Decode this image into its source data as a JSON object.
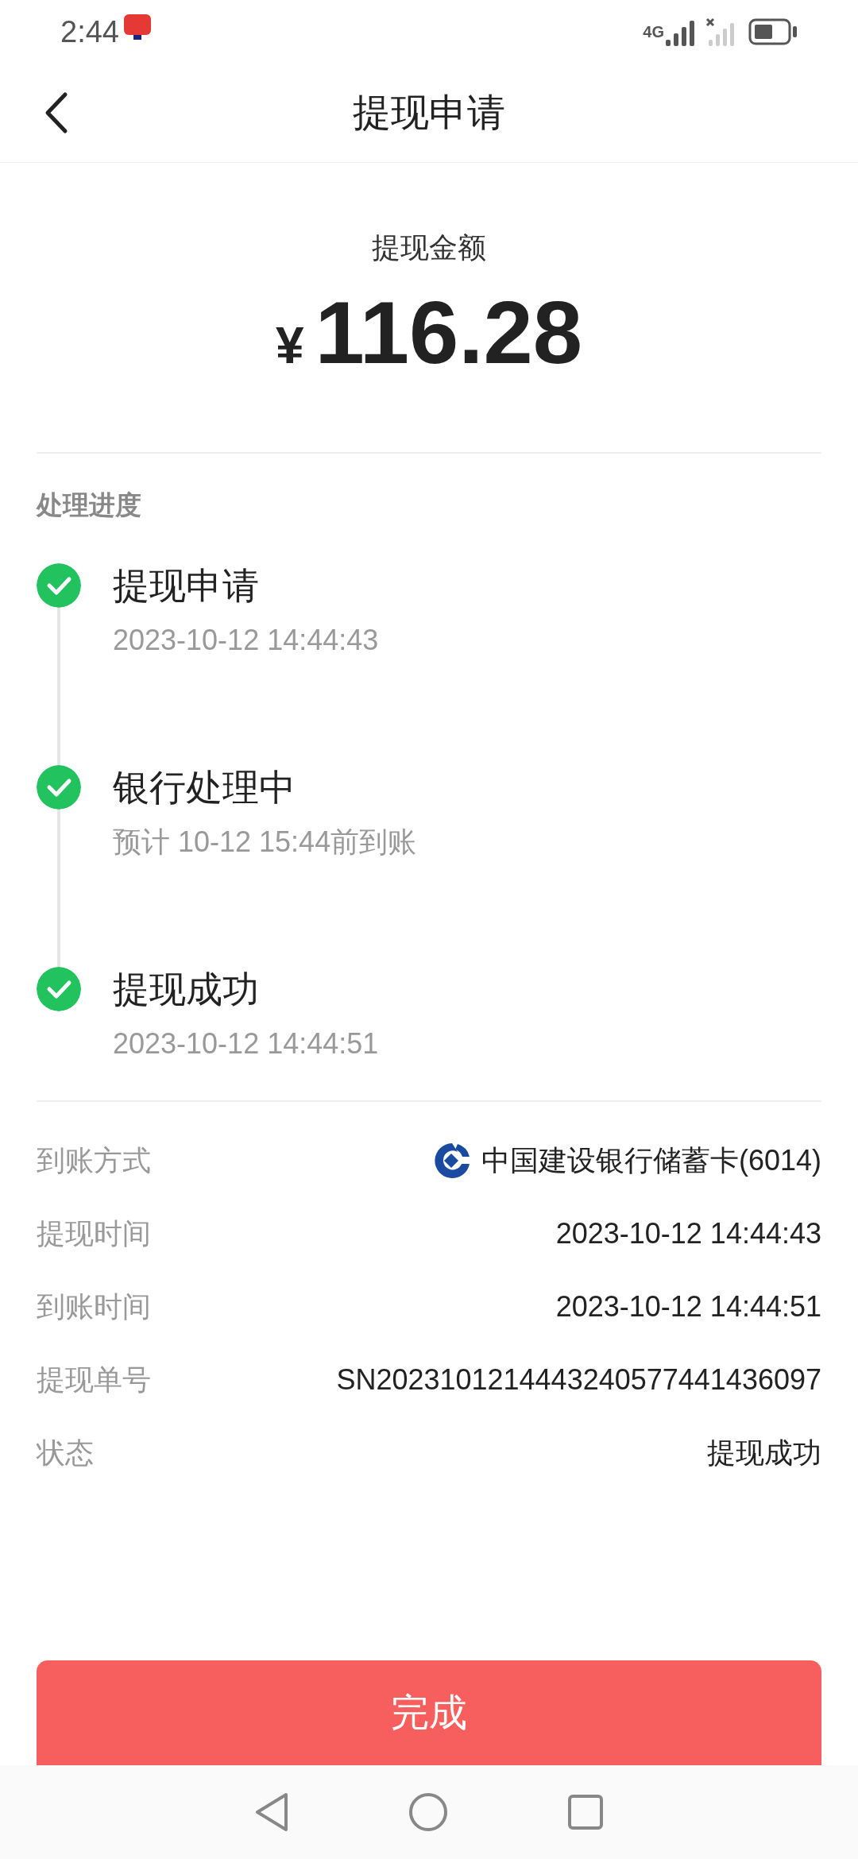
{
  "status_bar": {
    "time": "2:44",
    "network": "4G"
  },
  "header": {
    "title": "提现申请"
  },
  "amount": {
    "label": "提现金额",
    "currency": "¥",
    "value": "116.28"
  },
  "progress": {
    "title": "处理进度",
    "steps": [
      {
        "title": "提现申请",
        "detail": "2023-10-12 14:44:43",
        "completed": true
      },
      {
        "title": "银行处理中",
        "detail": "预计 10-12 15:44前到账",
        "completed": true
      },
      {
        "title": "提现成功",
        "detail": "2023-10-12 14:44:51",
        "completed": true
      }
    ]
  },
  "details": [
    {
      "label": "到账方式",
      "value": "中国建设银行储蓄卡(6014)",
      "kind": "bank"
    },
    {
      "label": "提现时间",
      "value": "2023-10-12 14:44:43",
      "kind": "text"
    },
    {
      "label": "到账时间",
      "value": "2023-10-12 14:44:51",
      "kind": "text"
    },
    {
      "label": "提现单号",
      "value": "SN2023101214443240577441436097",
      "kind": "text"
    },
    {
      "label": "状态",
      "value": "提现成功",
      "kind": "text"
    }
  ],
  "done_button": "完成"
}
